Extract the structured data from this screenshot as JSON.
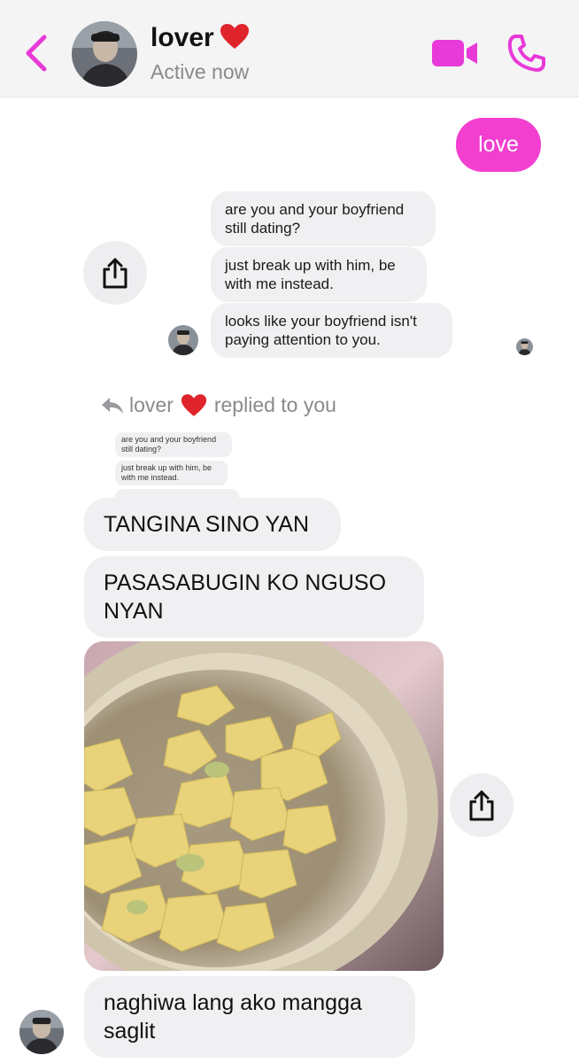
{
  "header": {
    "name": "lover",
    "status": "Active now",
    "back_icon": "chevron-left-icon",
    "video_icon": "video-camera-icon",
    "phone_icon": "phone-icon",
    "accent_color": "#e83ad8"
  },
  "messages": {
    "sent_love": "love",
    "quoted": [
      "are you and your boyfriend still dating?",
      "just break up with him, be with me instead.",
      "looks like your boyfriend isn't paying attention to you."
    ],
    "reply_name": "lover",
    "reply_text": "replied to you",
    "mini_quoted": [
      "are you and your boyfriend still dating?",
      "just break up with him, be with me instead."
    ],
    "reply_1": "TANGINA SINO YAN",
    "reply_2": "PASASABUGIN KO NGUSO NYAN",
    "reply_3": "naghiwa lang ako mangga saglit"
  },
  "colors": {
    "outgoing_bubble": "#f23fd0",
    "incoming_bubble": "#f0f0f2",
    "header_bg": "#f4f4f5"
  }
}
